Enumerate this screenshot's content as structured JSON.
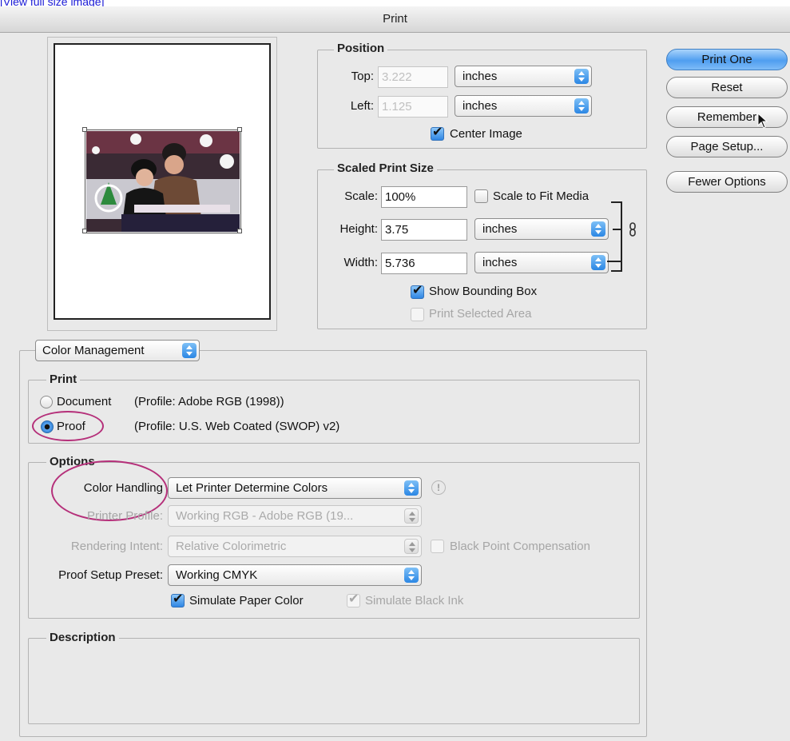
{
  "top_link": "[View full size image]",
  "window": {
    "title": "Print"
  },
  "buttons": {
    "print_one": "Print One",
    "reset": "Reset",
    "remember": "Remember",
    "page_setup": "Page Setup...",
    "fewer_options": "Fewer Options"
  },
  "position": {
    "legend": "Position",
    "top_label": "Top:",
    "top_value": "3.222",
    "top_unit": "inches",
    "left_label": "Left:",
    "left_value": "1.125",
    "left_unit": "inches",
    "center_image_label": "Center Image",
    "center_image_checked": true
  },
  "scaled": {
    "legend": "Scaled Print Size",
    "scale_label": "Scale:",
    "scale_value": "100%",
    "scale_to_fit_label": "Scale to Fit Media",
    "height_label": "Height:",
    "height_value": "3.75",
    "height_unit": "inches",
    "width_label": "Width:",
    "width_value": "5.736",
    "width_unit": "inches",
    "show_bbox_label": "Show Bounding Box",
    "print_selected_label": "Print Selected Area"
  },
  "section_popup": "Color Management",
  "print_group": {
    "legend": "Print",
    "document_label": "Document",
    "document_profile": "(Profile: Adobe RGB (1998))",
    "proof_label": "Proof",
    "proof_profile": "(Profile: U.S. Web Coated (SWOP) v2)"
  },
  "options_group": {
    "legend": "Options",
    "color_handling_label": "Color Handling",
    "color_handling_value": "Let Printer Determine Colors",
    "alert_glyph": "!",
    "printer_profile_label": "Printer Profile:",
    "printer_profile_value": "Working RGB - Adobe RGB (19...",
    "rendering_intent_label": "Rendering Intent:",
    "rendering_intent_value": "Relative Colorimetric",
    "black_point_label": "Black Point Compensation",
    "proof_setup_label": "Proof Setup Preset:",
    "proof_setup_value": "Working CMYK",
    "simulate_paper_label": "Simulate Paper Color",
    "simulate_black_label": "Simulate Black Ink"
  },
  "description_group": {
    "legend": "Description"
  },
  "colors": {
    "accent": "#2b86e4",
    "highlight_circle": "#b5307a"
  }
}
